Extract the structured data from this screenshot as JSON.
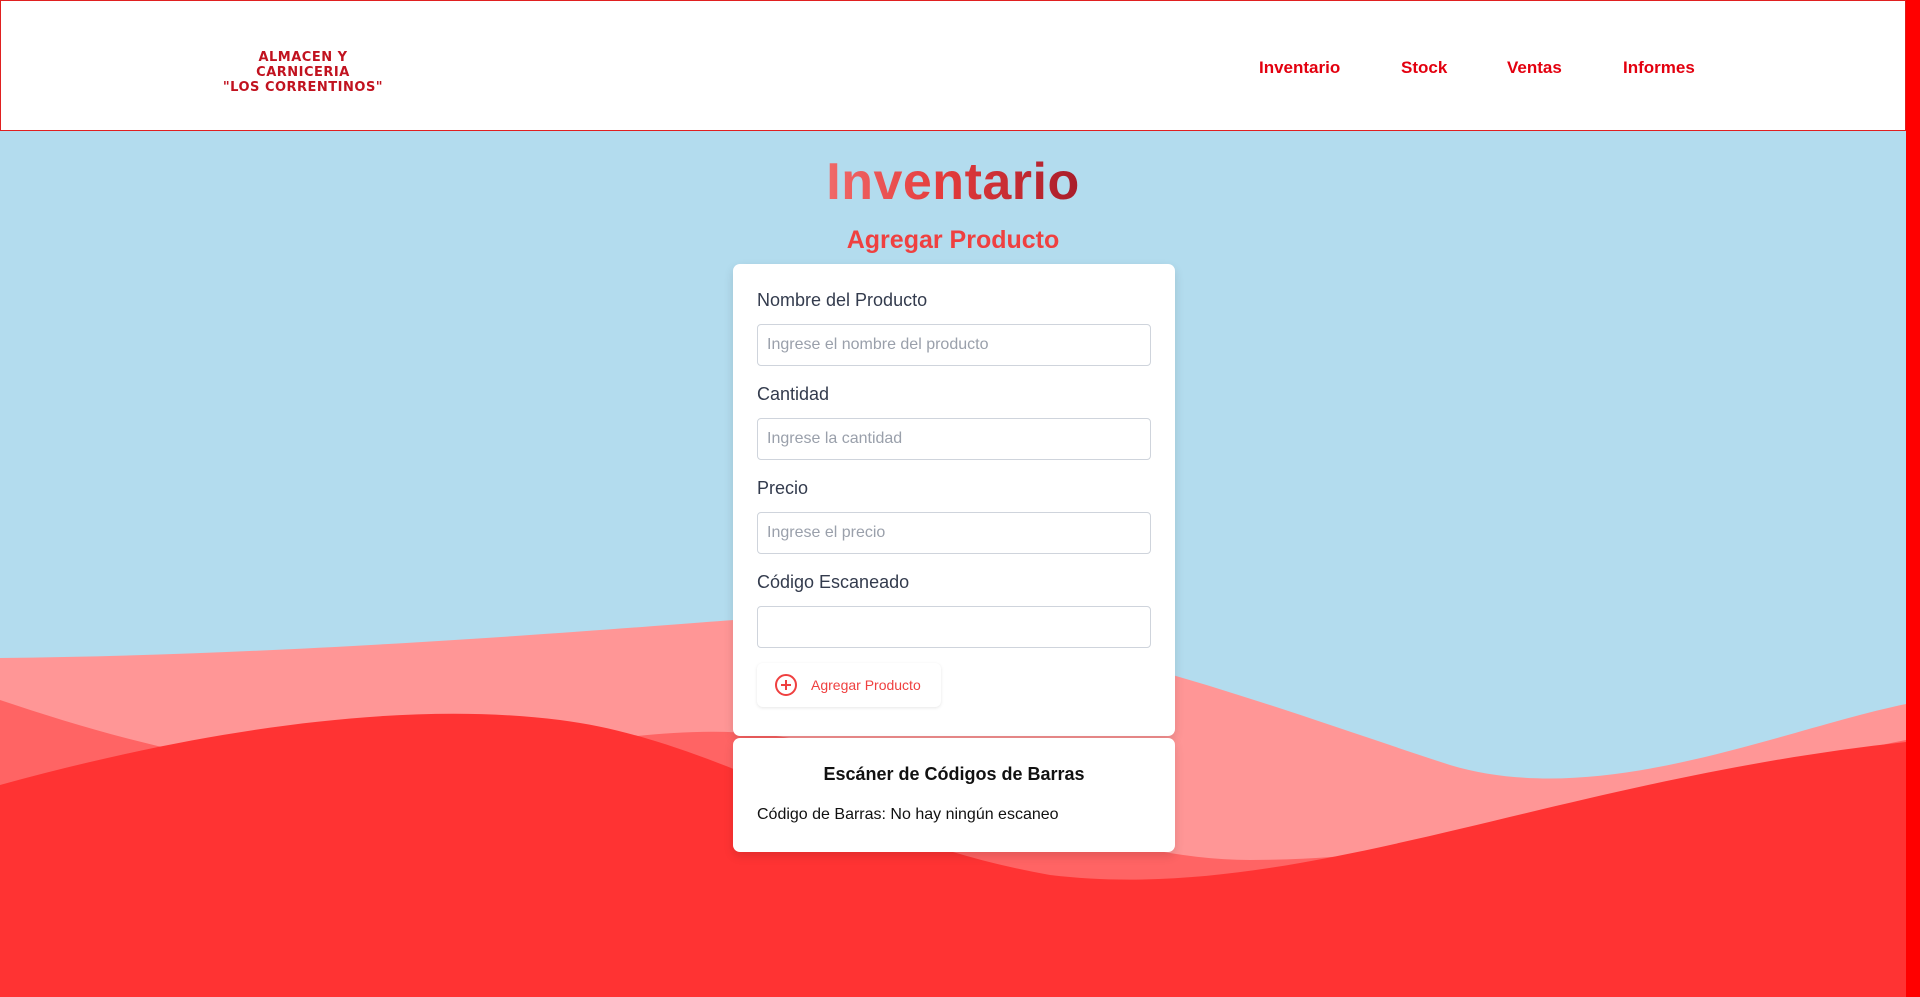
{
  "brand": {
    "line1": "ALMACEN Y CARNICERIA",
    "line2": "\"LOS CORRENTINOS\""
  },
  "nav": {
    "items": [
      "Inventario",
      "Stock",
      "Ventas",
      "Informes"
    ]
  },
  "page": {
    "title": "Inventario",
    "subtitle": "Agregar Producto"
  },
  "form": {
    "name": {
      "label": "Nombre del Producto",
      "placeholder": "Ingrese el nombre del producto",
      "value": ""
    },
    "quantity": {
      "label": "Cantidad",
      "placeholder": "Ingrese la cantidad",
      "value": ""
    },
    "price": {
      "label": "Precio",
      "placeholder": "Ingrese el precio",
      "value": ""
    },
    "code": {
      "label": "Código Escaneado",
      "placeholder": "",
      "value": ""
    },
    "submit_label": "Agregar Producto",
    "submit_icon": "plus-circle-icon"
  },
  "scanner": {
    "title": "Escáner de Códigos de Barras",
    "status_prefix": "Código de Barras:",
    "status_value": "No hay ningún escaneo"
  },
  "colors": {
    "accent": "#e3000f",
    "header_border": "#e02020",
    "sky": "#b3dcee",
    "wave_light": "#ff9696",
    "wave_mid": "#ff6464",
    "wave_dark": "#ff3333"
  }
}
